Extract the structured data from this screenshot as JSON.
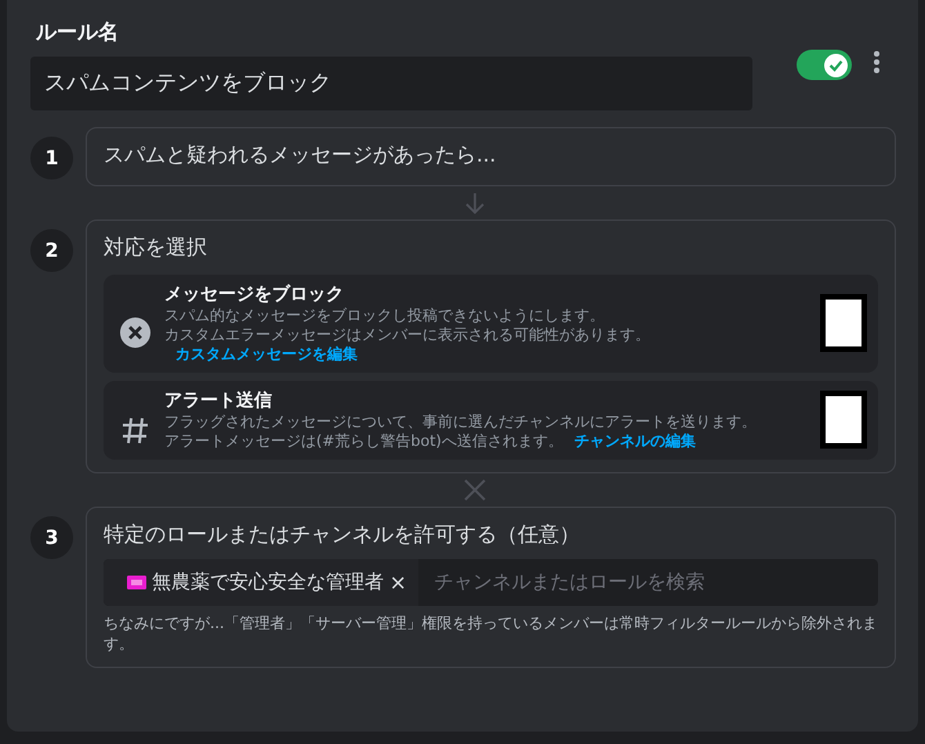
{
  "rule_name": {
    "label": "ルール名",
    "value": "スパムコンテンツをブロック"
  },
  "enabled": true,
  "steps": [
    {
      "number": "1",
      "kind": "trigger",
      "text": "スパムと疑われるメッセージがあったら..."
    },
    {
      "number": "2",
      "kind": "actions",
      "title": "対応を選択",
      "actions": [
        {
          "kind": "block",
          "title": "メッセージをブロック",
          "description": "スパム的なメッセージをブロックし投稿できないようにします。",
          "note": "カスタムエラーメッセージはメンバーに表示される可能性があります。",
          "link": "カスタムメッセージを編集"
        },
        {
          "kind": "alert",
          "title": "アラート送信",
          "description": "フラッグされたメッセージについて、事前に選んだチャンネルにアラートを送ります。",
          "note": "アラートメッセージは(#荒らし警告bot)へ送信されます。",
          "link": "チャンネルの編集"
        }
      ]
    },
    {
      "number": "3",
      "kind": "exemptions",
      "title": "特定のロールまたはチャンネルを許可する（任意）",
      "tags": [
        {
          "label": "無農薬で安心安全な管理者",
          "remove": "×"
        }
      ],
      "placeholder": "チャンネルまたはロールを検索",
      "hint": "ちなみにですが...「管理者」「サーバー管理」権限を持っているメンバーは常時フィルタールールから除外されます。"
    }
  ],
  "connectors": [
    {
      "kind": "arrow"
    },
    {
      "kind": "cross"
    }
  ]
}
